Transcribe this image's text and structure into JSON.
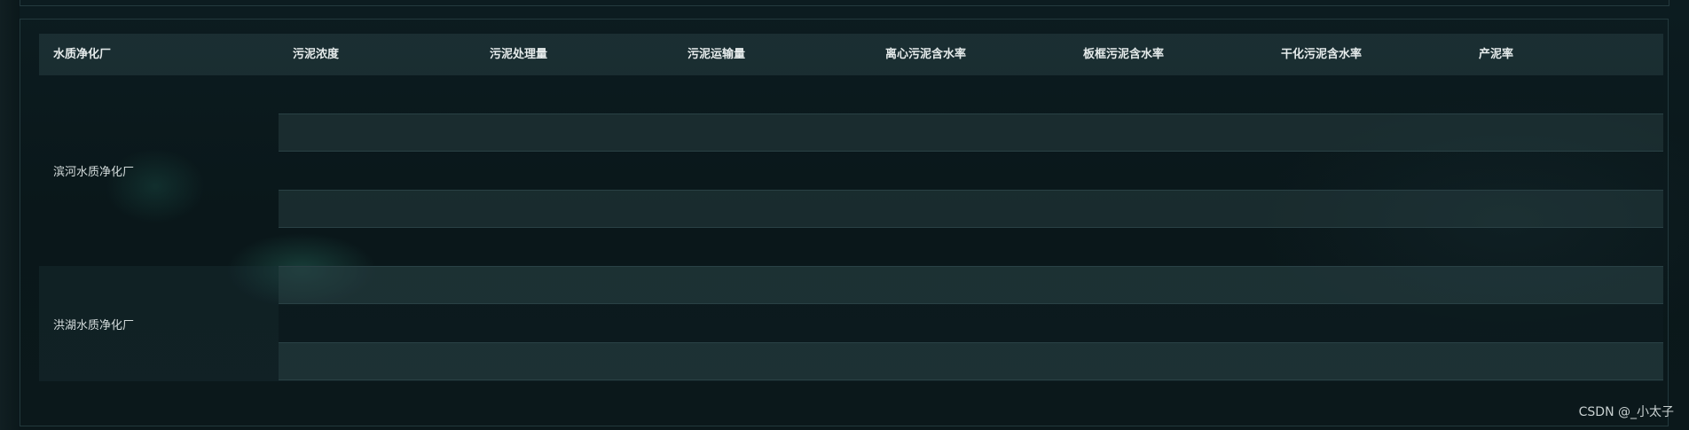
{
  "table": {
    "headers": [
      "水质净化厂",
      "污泥浓度",
      "污泥处理量",
      "污泥运输量",
      "离心污泥含水率",
      "板框污泥含水率",
      "干化污泥含水率",
      "产泥率"
    ],
    "plants": [
      {
        "name": "滨河水质净化厂",
        "rows": 4
      },
      {
        "name": "洪湖水质净化厂",
        "rows": 3
      }
    ]
  },
  "watermark": "CSDN @_小太子",
  "colors": {
    "background": "#0a1a1d",
    "header_bg": "#1f3236",
    "border": "#23393d",
    "text": "#e6ecec"
  }
}
